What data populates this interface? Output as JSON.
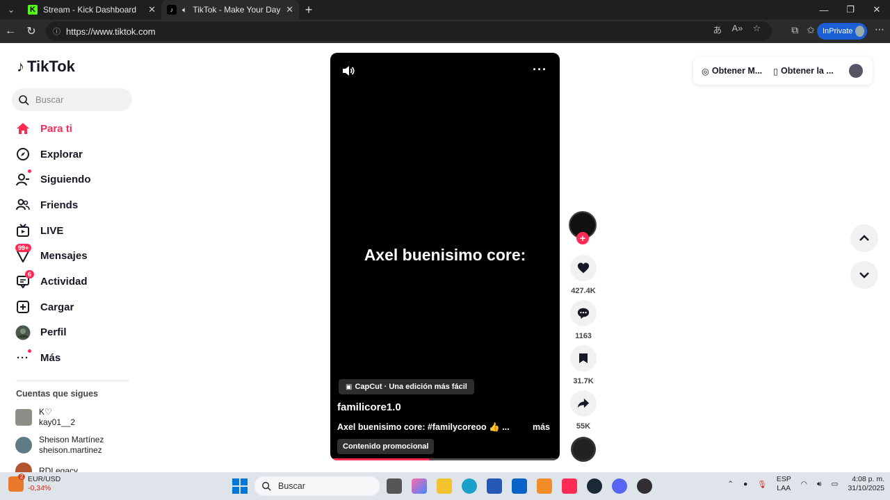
{
  "browser": {
    "tabs": [
      {
        "title": "Stream - Kick Dashboard"
      },
      {
        "title": "TikTok - Make Your Day"
      }
    ],
    "url": "https://www.tiktok.com",
    "inprivate_label": "InPrivate"
  },
  "sidebar": {
    "logo_text": "TikTok",
    "search_placeholder": "Buscar",
    "items": [
      {
        "label": "Para ti",
        "icon": "home-icon"
      },
      {
        "label": "Explorar",
        "icon": "compass-icon"
      },
      {
        "label": "Siguiendo",
        "icon": "following-icon"
      },
      {
        "label": "Friends",
        "icon": "friends-icon"
      },
      {
        "label": "LIVE",
        "icon": "live-icon"
      },
      {
        "label": "Mensajes",
        "icon": "messages-icon",
        "badge": "99+"
      },
      {
        "label": "Actividad",
        "icon": "activity-icon",
        "badge": "6"
      },
      {
        "label": "Cargar",
        "icon": "upload-icon"
      },
      {
        "label": "Perfil",
        "icon": "avatar"
      },
      {
        "label": "Más",
        "icon": "more-icon"
      }
    ],
    "following_title": "Cuentas que sigues",
    "accounts": [
      {
        "name": "K♡",
        "handle": "kay01__2"
      },
      {
        "name": "Sheison Martínez",
        "handle": "sheison.martinez"
      },
      {
        "name": "RDLegacy",
        "handle": ""
      }
    ]
  },
  "video": {
    "caption": "Axel buenisimo core:",
    "capcut_label": "CapCut · Una edición más fácil",
    "author": "familicore1.0",
    "description": "Axel buenisimo core: #familycoreoo 👍 ...",
    "more_label": "más",
    "promo_label": "Contenido promocional",
    "progress": 0.43
  },
  "actions": {
    "likes": "427.4K",
    "comments": "1163",
    "saves": "31.7K",
    "shares": "55K"
  },
  "topright": {
    "get_app_1": "Obtener M...",
    "get_app_2": "Obtener la ..."
  },
  "taskbar": {
    "ticker_symbol": "EUR/USD",
    "ticker_change": "-0,34%",
    "ticker_badge": "2",
    "search_label": "Buscar",
    "lang_1": "ESP",
    "lang_2": "LAA",
    "time": "4:08 p. m.",
    "date": "31/10/2025"
  },
  "colors": {
    "brand": "#fe2c55",
    "chrome": "#1f1f1f"
  }
}
